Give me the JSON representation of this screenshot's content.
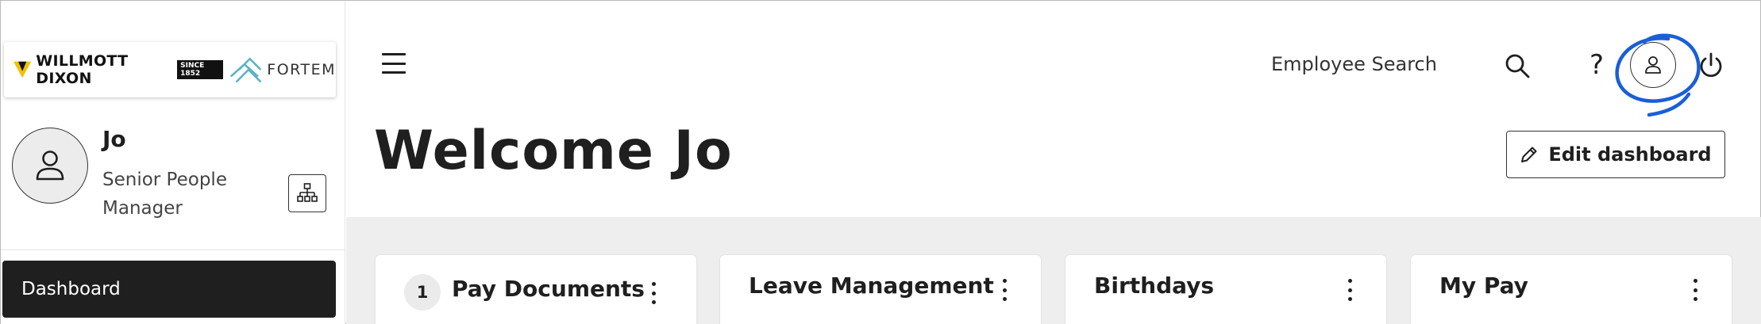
{
  "brand": {
    "logo_primary": "WILLMOTT DIXON",
    "logo_since": "SINCE 1852",
    "logo_secondary": "FORTEM",
    "accent_yellow": "#f2c100",
    "accent_teal": "#5ab4c5"
  },
  "user": {
    "name": "Jo",
    "role": "Senior People Manager"
  },
  "sidebar": {
    "items": [
      {
        "label": "Dashboard",
        "active": true,
        "icon": "none"
      }
    ],
    "org_chart_icon": "org-chart-icon"
  },
  "header": {
    "menu_icon": "hamburger-icon",
    "employee_search_label": "Employee Search",
    "icons": [
      "search-icon",
      "help-icon",
      "user-icon",
      "power-icon"
    ],
    "annotation_color": "#1a5ed8"
  },
  "main": {
    "welcome": "Welcome Jo",
    "edit_dashboard_label": "Edit dashboard"
  },
  "widgets": [
    {
      "title": "Pay Documents",
      "badge": "1"
    },
    {
      "title": "Leave Management"
    },
    {
      "title": "Birthdays"
    },
    {
      "title": "My Pay"
    }
  ]
}
